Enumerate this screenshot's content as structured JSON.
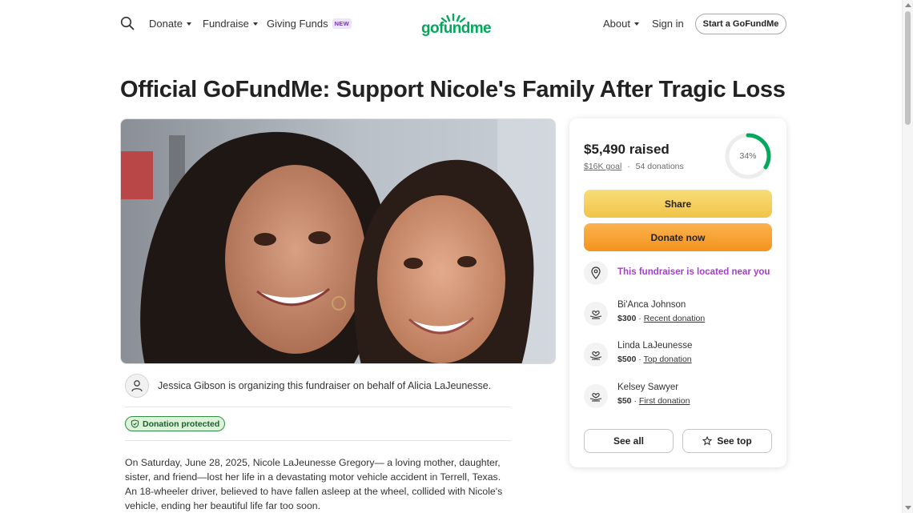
{
  "header": {
    "nav": [
      {
        "label": "Donate"
      },
      {
        "label": "Fundraise"
      },
      {
        "label": "Giving Funds",
        "badge": "NEW"
      }
    ],
    "logo_text": "gofundme",
    "about_label": "About",
    "signin_label": "Sign in",
    "start_label": "Start a GoFundMe"
  },
  "page": {
    "title": "Official GoFundMe: Support Nicole's Family After Tragic Loss"
  },
  "organizer": {
    "text": "Jessica Gibson is organizing this fundraiser on behalf of Alicia LaJeunesse."
  },
  "protection": {
    "label": "Donation protected"
  },
  "story": {
    "text": "On Saturday, June 28, 2025, Nicole LaJeunesse Gregory— a loving mother, daughter, sister, and friend—lost her life in a devastating motor vehicle accident in Terrell, Texas. An 18-wheeler driver, believed to have fallen asleep at the wheel, collided with Nicole's vehicle, ending her beautiful life far too soon."
  },
  "donation_card": {
    "raised": "$5,490 raised",
    "goal": "$16K goal",
    "separator": "·",
    "donations_count": "54 donations",
    "progress_label": "34%",
    "progress_fraction": 0.34,
    "share_label": "Share",
    "donate_label": "Donate now",
    "near_label": "This fundraiser is located near you",
    "donors": [
      {
        "name": "Bi'Anca Johnson",
        "amount": "$300",
        "tag": "Recent donation"
      },
      {
        "name": "Linda LaJeunesse",
        "amount": "$500",
        "tag": "Top donation"
      },
      {
        "name": "Kelsey Sawyer",
        "amount": "$50",
        "tag": "First donation"
      }
    ],
    "see_all_label": "See all",
    "see_top_label": "See top"
  },
  "colors": {
    "brand_green": "#02a95c",
    "share_yellow": "#f0c44a",
    "donate_orange": "#f4931f",
    "near_purple": "#a83bd3",
    "protected_green": "#2e8c44"
  },
  "icons": {
    "search": "search-icon",
    "caret": "chevron-down-icon",
    "person": "person-icon",
    "shield": "shield-check-icon",
    "location": "location-pin-icon",
    "donor": "heart-hand-icon",
    "star": "star-icon"
  }
}
